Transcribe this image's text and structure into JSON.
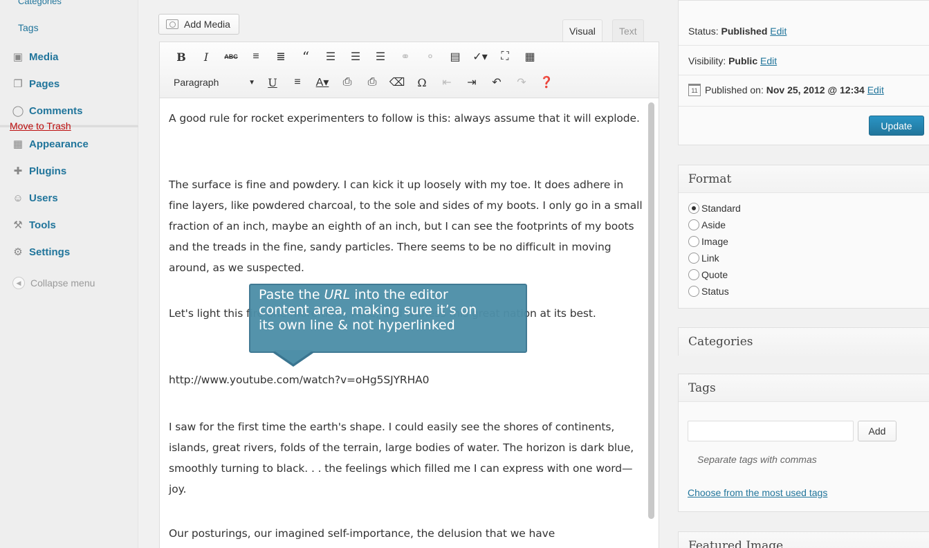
{
  "sidebar": {
    "top_partial": "Categories",
    "tags": "Tags",
    "items": [
      {
        "label": "Media",
        "icon": "media-icon"
      },
      {
        "label": "Pages",
        "icon": "pages-icon"
      },
      {
        "label": "Comments",
        "icon": "comments-icon"
      },
      {
        "label": "Appearance",
        "icon": "appearance-icon"
      },
      {
        "label": "Plugins",
        "icon": "plugins-icon"
      },
      {
        "label": "Users",
        "icon": "users-icon"
      },
      {
        "label": "Tools",
        "icon": "tools-icon"
      },
      {
        "label": "Settings",
        "icon": "settings-icon"
      }
    ],
    "collapse": "Collapse menu"
  },
  "editor": {
    "add_media": "Add Media",
    "tabs": {
      "visual": "Visual",
      "text": "Text"
    },
    "format_select": "Paragraph",
    "paragraphs": [
      "A good rule for rocket experimenters to follow is this: always assume that it will explode.",
      "The surface is fine and powdery. I can kick it up loosely with my toe. It does adhere in fine layers, like powdered charcoal, to the sole and sides of my boots. I only go in a small fraction of an inch, maybe an eighth of an inch, but I can see the footprints of my boots and the treads in the fine, sandy particles. There seems to be no difficult in moving around, as we suspected.",
      "Let's light this fire one more time, Mike, and witness this great nation at its best.",
      "http://www.youtube.com/watch?v=oHg5SJYRHA0",
      "I saw for the first time the earth's shape. I could easily see the shores of continents, islands, great rivers, folds of the terrain, large bodies of water. The horizon is dark blue, smoothly turning to black. . . the feelings which filled me I can express with one word—joy.",
      "Our posturings, our imagined self-importance, the delusion that we have"
    ]
  },
  "tooltip": {
    "line1_pre": "Paste the ",
    "line1_em": "URL",
    "line1_post": " into the editor",
    "line2": "content area, making sure it’s on",
    "line3": "its own line & not hyperlinked"
  },
  "publish": {
    "status_label": "Status:",
    "status_value": "Published",
    "visibility_label": "Visibility:",
    "visibility_value": "Public",
    "published_label": "Published on:",
    "published_value": "Nov 25, 2012 @ 12:34",
    "edit": "Edit",
    "trash": "Move to Trash",
    "update": "Update",
    "calendar_day": "11"
  },
  "format": {
    "title": "Format",
    "options": [
      "Standard",
      "Aside",
      "Image",
      "Link",
      "Quote",
      "Status"
    ],
    "selected": "Standard"
  },
  "categories": {
    "title": "Categories"
  },
  "tags": {
    "title": "Tags",
    "add": "Add",
    "hint": "Separate tags with commas",
    "choose": "Choose from the most used tags"
  },
  "featured": {
    "title": "Featured Image"
  },
  "colors": {
    "accent": "#21759b",
    "tooltip": "#4e8fa8",
    "update": "#2a95c5",
    "trash": "#bc0b0b"
  }
}
